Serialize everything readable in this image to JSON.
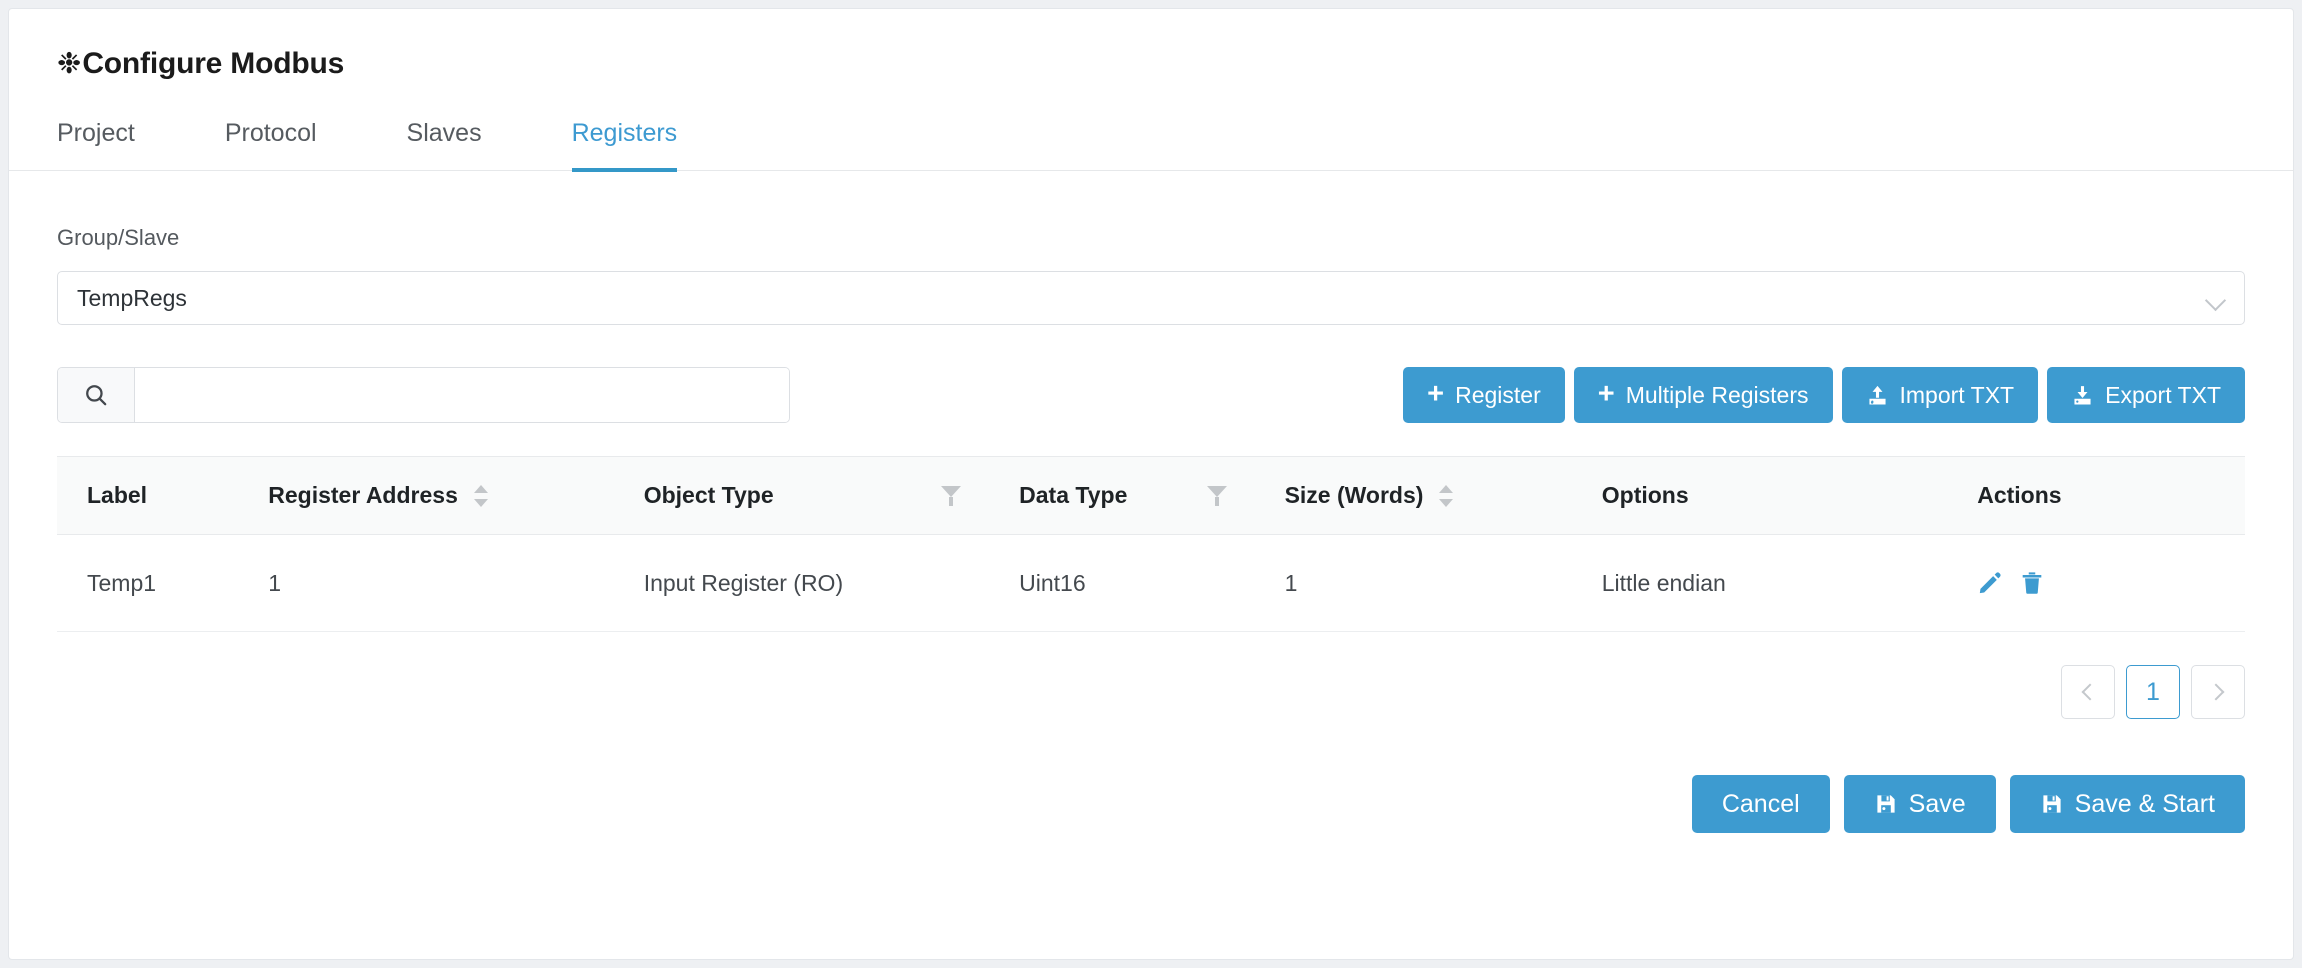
{
  "page": {
    "title": "Configure Modbus",
    "title_icon": "gear-icon",
    "accent_color": "#3d9bd0",
    "active_tab_color": "#3d9ad1"
  },
  "tabs": [
    {
      "label": "Project",
      "active": false
    },
    {
      "label": "Protocol",
      "active": false
    },
    {
      "label": "Slaves",
      "active": false
    },
    {
      "label": "Registers",
      "active": true
    }
  ],
  "group_slave": {
    "label": "Group/Slave",
    "selected": "TempRegs",
    "options": [
      "TempRegs"
    ]
  },
  "search": {
    "value": "",
    "placeholder": "",
    "icon": "search-icon"
  },
  "toolbar": {
    "add_register": "Register",
    "add_multiple_registers": "Multiple Registers",
    "import_txt": "Import TXT",
    "export_txt": "Export TXT",
    "plus_glyph": "+"
  },
  "table": {
    "columns": [
      {
        "label": "Label",
        "sortable": false,
        "filterable": false
      },
      {
        "label": "Register Address",
        "sortable": true,
        "filterable": false
      },
      {
        "label": "Object Type",
        "sortable": false,
        "filterable": true
      },
      {
        "label": "Data Type",
        "sortable": false,
        "filterable": true
      },
      {
        "label": "Size (Words)",
        "sortable": true,
        "filterable": false
      },
      {
        "label": "Options",
        "sortable": false,
        "filterable": false
      },
      {
        "label": "Actions",
        "sortable": false,
        "filterable": false
      }
    ],
    "rows": [
      {
        "label": "Temp1",
        "register_address": "1",
        "object_type": "Input Register (RO)",
        "data_type": "Uint16",
        "size_words": "1",
        "options": "Little endian"
      }
    ]
  },
  "pagination": {
    "prev": "‹",
    "next": "›",
    "pages": [
      "1"
    ],
    "current_page": "1"
  },
  "footer": {
    "cancel": "Cancel",
    "save": "Save",
    "save_and_start": "Save & Start"
  }
}
